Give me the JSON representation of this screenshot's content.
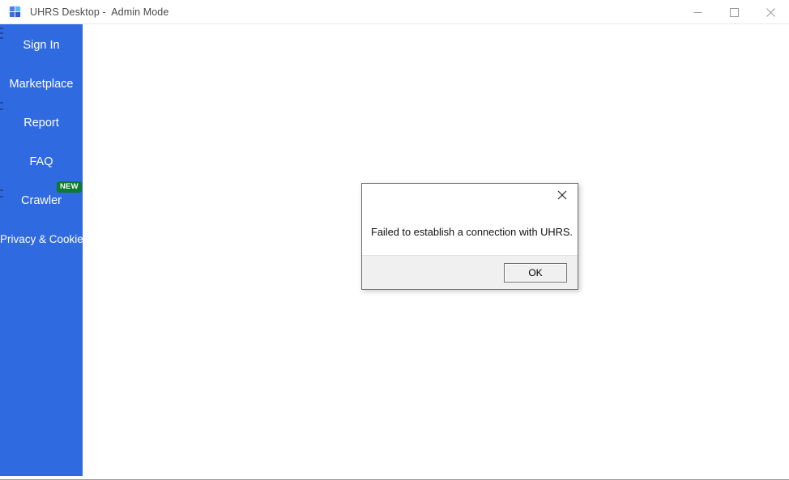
{
  "window": {
    "title": "UHRS Desktop -  Admin Mode",
    "app_icon": "uhrs-app-icon",
    "controls": {
      "minimize": "minimize-icon",
      "maximize": "maximize-icon",
      "close": "close-icon"
    }
  },
  "sidebar": {
    "background_color": "#2f6ae1",
    "text_color": "#ffffff",
    "items": [
      {
        "label": "Sign In",
        "badge": null
      },
      {
        "label": "Marketplace",
        "badge": null
      },
      {
        "label": "Report",
        "badge": null
      },
      {
        "label": "FAQ",
        "badge": null
      },
      {
        "label": "Crawler",
        "badge": "NEW"
      },
      {
        "label": "Privacy & Cookies",
        "badge": null
      }
    ],
    "badge_color": "#0d7a2f"
  },
  "dialog": {
    "message": "Failed to establish a connection with UHRS.",
    "ok_label": "OK",
    "close_icon": "close-icon",
    "footer_color": "#f0f0f0",
    "border_color": "#6b6b6b"
  }
}
